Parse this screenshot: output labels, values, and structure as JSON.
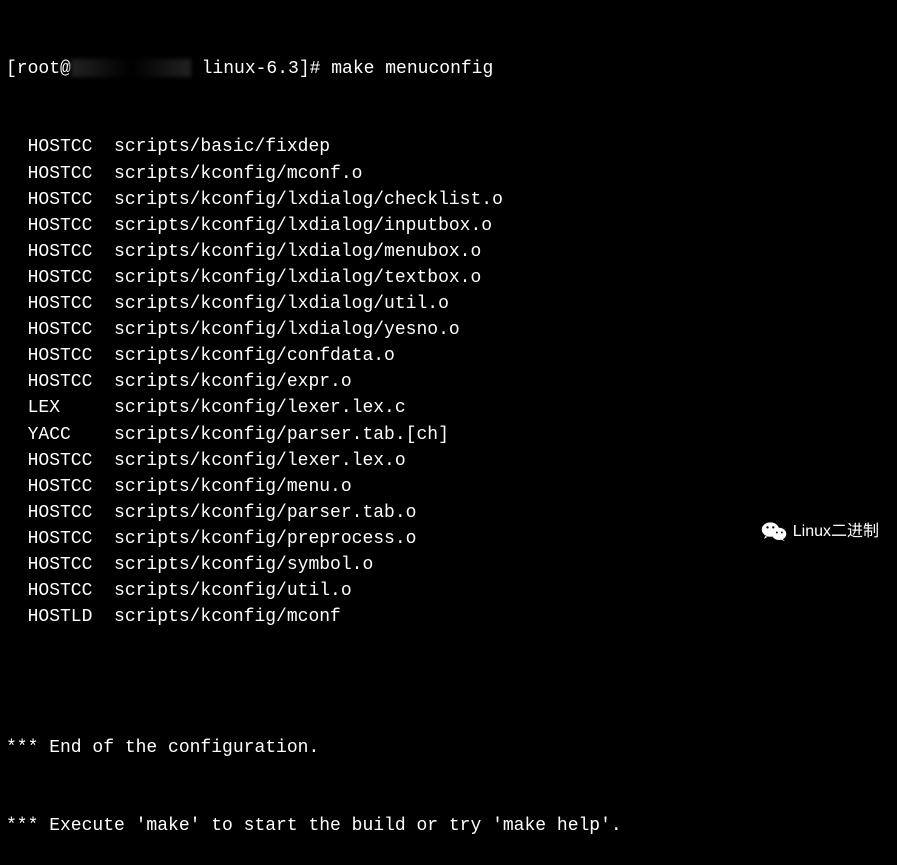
{
  "prompt": {
    "user_host_prefix": "[root@",
    "redacted_host": "████████",
    "cwd": " linux-6.3]# ",
    "command": "make menuconfig"
  },
  "build_lines": [
    {
      "label": "HOSTCC",
      "path": "scripts/basic/fixdep"
    },
    {
      "label": "HOSTCC",
      "path": "scripts/kconfig/mconf.o"
    },
    {
      "label": "HOSTCC",
      "path": "scripts/kconfig/lxdialog/checklist.o"
    },
    {
      "label": "HOSTCC",
      "path": "scripts/kconfig/lxdialog/inputbox.o"
    },
    {
      "label": "HOSTCC",
      "path": "scripts/kconfig/lxdialog/menubox.o"
    },
    {
      "label": "HOSTCC",
      "path": "scripts/kconfig/lxdialog/textbox.o"
    },
    {
      "label": "HOSTCC",
      "path": "scripts/kconfig/lxdialog/util.o"
    },
    {
      "label": "HOSTCC",
      "path": "scripts/kconfig/lxdialog/yesno.o"
    },
    {
      "label": "HOSTCC",
      "path": "scripts/kconfig/confdata.o"
    },
    {
      "label": "HOSTCC",
      "path": "scripts/kconfig/expr.o"
    },
    {
      "label": "LEX",
      "path": "scripts/kconfig/lexer.lex.c"
    },
    {
      "label": "YACC",
      "path": "scripts/kconfig/parser.tab.[ch]"
    },
    {
      "label": "HOSTCC",
      "path": "scripts/kconfig/lexer.lex.o"
    },
    {
      "label": "HOSTCC",
      "path": "scripts/kconfig/menu.o"
    },
    {
      "label": "HOSTCC",
      "path": "scripts/kconfig/parser.tab.o"
    },
    {
      "label": "HOSTCC",
      "path": "scripts/kconfig/preprocess.o"
    },
    {
      "label": "HOSTCC",
      "path": "scripts/kconfig/symbol.o"
    },
    {
      "label": "HOSTCC",
      "path": "scripts/kconfig/util.o"
    },
    {
      "label": "HOSTLD",
      "path": "scripts/kconfig/mconf"
    }
  ],
  "footer": {
    "blank": "",
    "line1": "*** End of the configuration.",
    "line2": "*** Execute 'make' to start the build or try 'make help'."
  },
  "watermark": {
    "text": "Linux二进制"
  }
}
